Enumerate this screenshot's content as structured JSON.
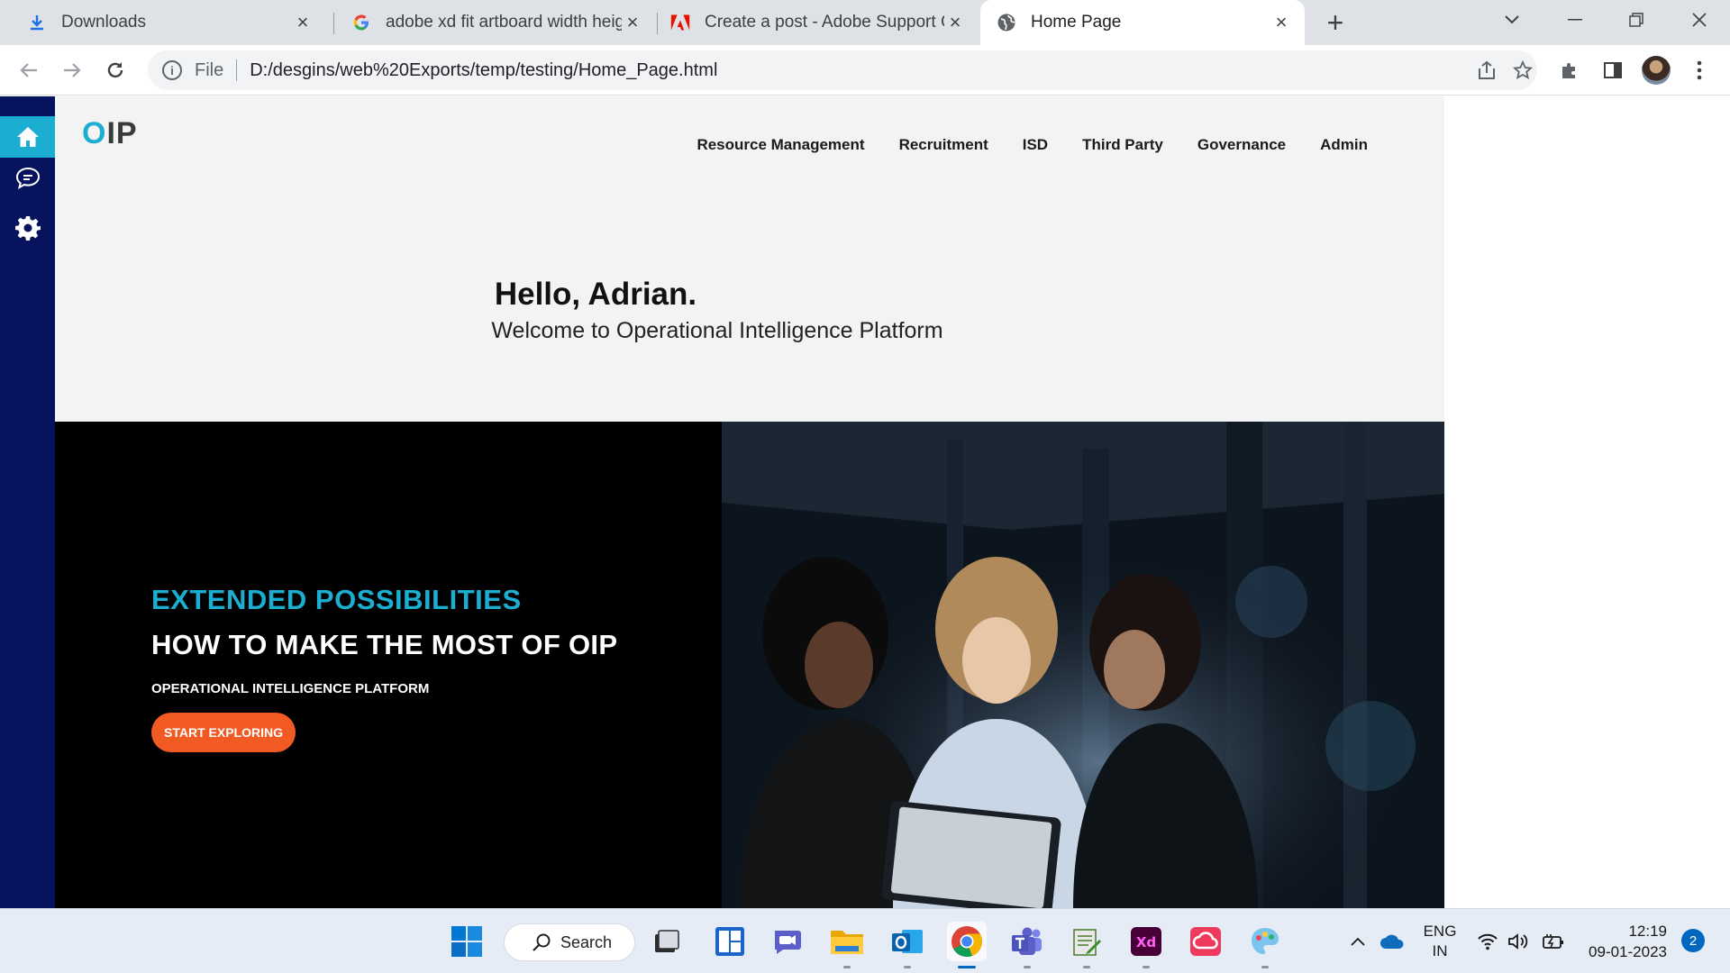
{
  "browser": {
    "tabs": [
      {
        "title": "Downloads",
        "favicon": "download-icon",
        "active": false
      },
      {
        "title": "adobe xd fit artboard width heig",
        "favicon": "google-icon",
        "active": false
      },
      {
        "title": "Create a post - Adobe Support C",
        "favicon": "adobe-icon",
        "active": false
      },
      {
        "title": "Home Page",
        "favicon": "globe-icon",
        "active": true
      }
    ],
    "address": {
      "scheme": "File",
      "url": "D:/desgins/web%20Exports/temp/testing/Home_Page.html"
    }
  },
  "page": {
    "logo": {
      "o": "O",
      "rest": "IP"
    },
    "nav": [
      "Resource Management",
      "Recruitment",
      "ISD",
      "Third Party",
      "Governance",
      "Admin"
    ],
    "greeting": {
      "title": "Hello, Adrian.",
      "subtitle": "Welcome to Operational Intelligence Platform"
    },
    "hero": {
      "kicker": "EXTENDED POSSIBILITIES",
      "title": "HOW TO MAKE THE MOST OF OIP",
      "subtitle": "OPERATIONAL INTELLIGENCE PLATFORM",
      "button": "START EXPLORING"
    },
    "colors": {
      "sidebar": "#07135e",
      "accent": "#1baed0",
      "cta": "#f25a24"
    }
  },
  "taskbar": {
    "search": "Search",
    "language": {
      "line1": "ENG",
      "line2": "IN"
    },
    "time": "12:19",
    "date": "09-01-2023",
    "notifications": "2"
  }
}
